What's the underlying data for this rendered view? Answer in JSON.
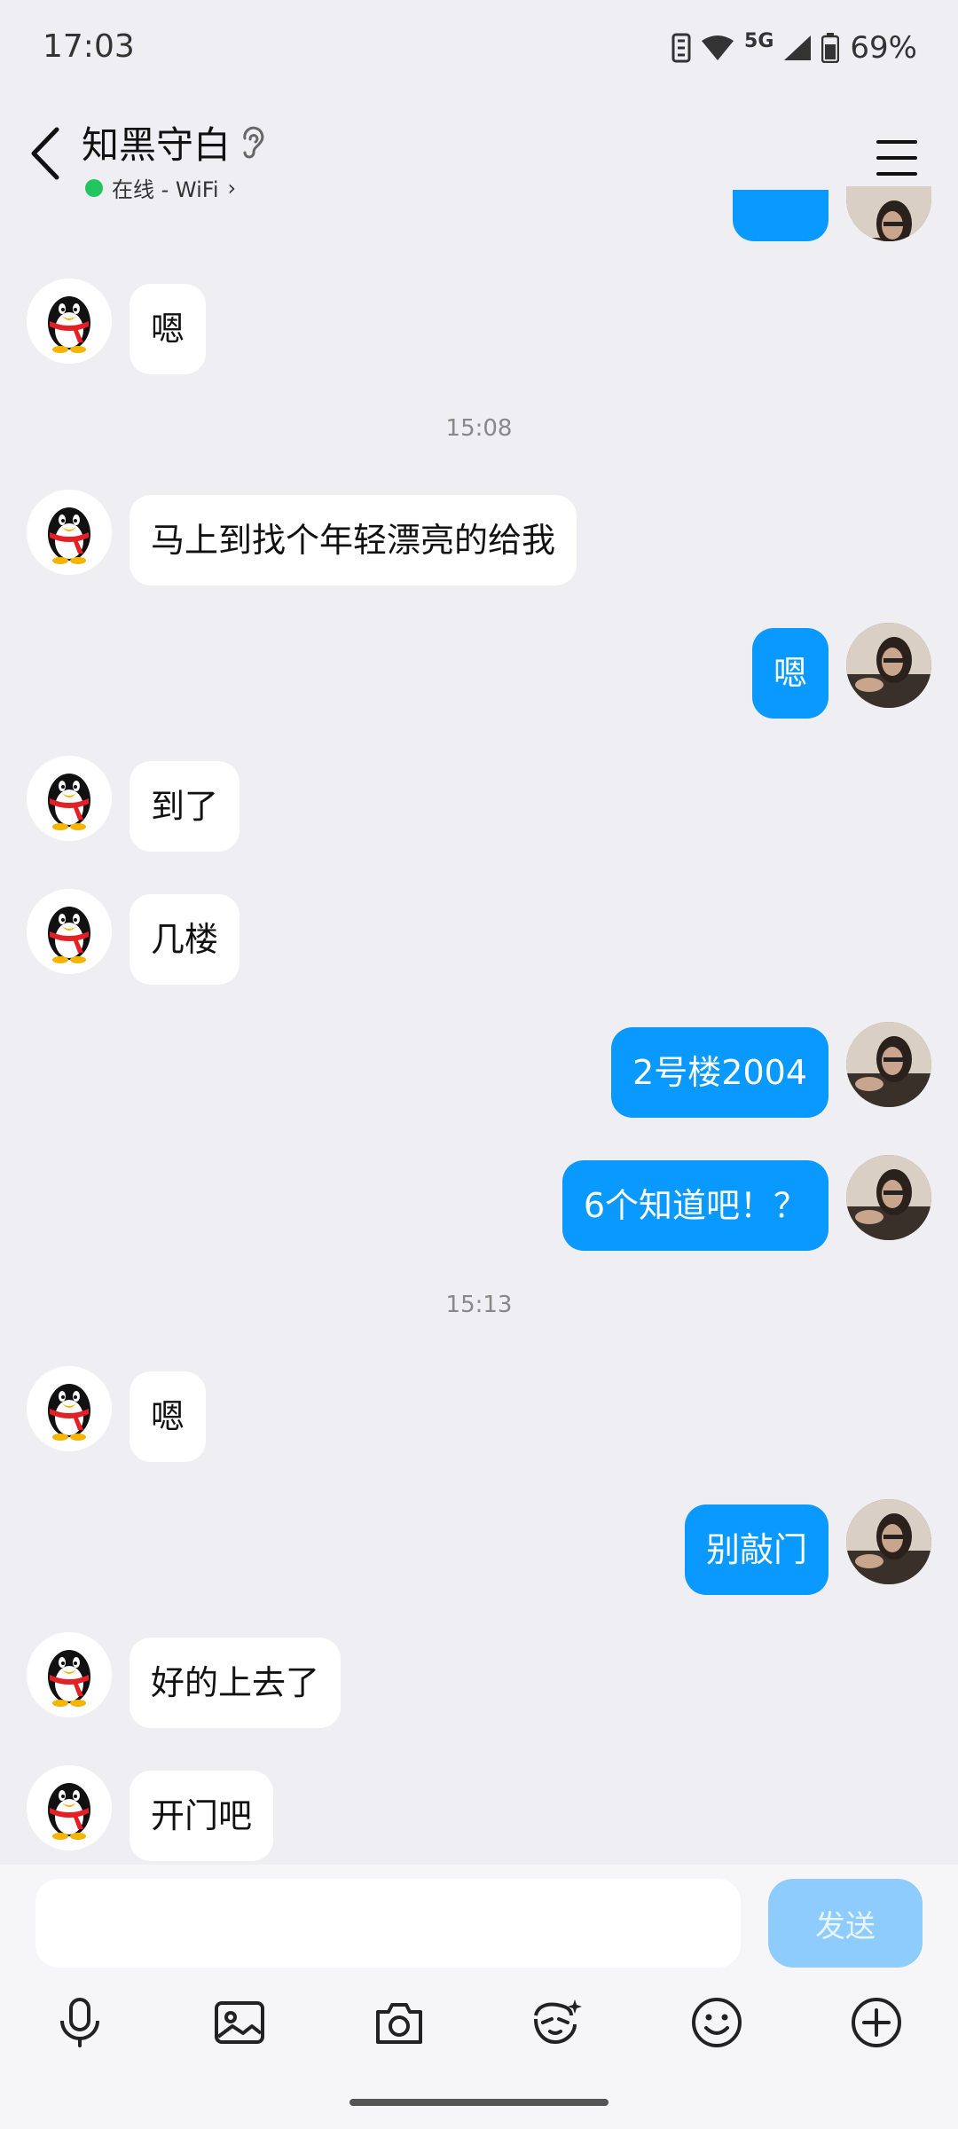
{
  "status_bar": {
    "time": "17:03",
    "battery": "69%",
    "network": "5G"
  },
  "header": {
    "name": "知黑守白",
    "presence": "在线 - WiFi"
  },
  "timestamps": [
    "15:08",
    "15:13"
  ],
  "messages": [
    {
      "from": "peer",
      "text": "嗯"
    },
    {
      "from": "peer",
      "text": "马上到找个年轻漂亮的给我"
    },
    {
      "from": "me",
      "text": "嗯"
    },
    {
      "from": "peer",
      "text": "到了"
    },
    {
      "from": "peer",
      "text": "几楼"
    },
    {
      "from": "me",
      "text": "2号楼2004"
    },
    {
      "from": "me",
      "text": "6个知道吧！？"
    },
    {
      "from": "peer",
      "text": "嗯"
    },
    {
      "from": "me",
      "text": "别敲门"
    },
    {
      "from": "peer",
      "text": "好的上去了"
    },
    {
      "from": "peer",
      "text": "开门吧"
    }
  ],
  "input": {
    "placeholder": "",
    "send_label": "发送"
  },
  "toolbar": [
    "microphone-icon",
    "image-icon",
    "camera-icon",
    "sticker-icon",
    "emoji-icon",
    "plus-icon"
  ],
  "colors": {
    "my_bubble": "#0a99ff",
    "peer_bubble": "#ffffff",
    "background": "#efeff3",
    "send_disabled": "#8dccfd",
    "online": "#22c55e"
  }
}
